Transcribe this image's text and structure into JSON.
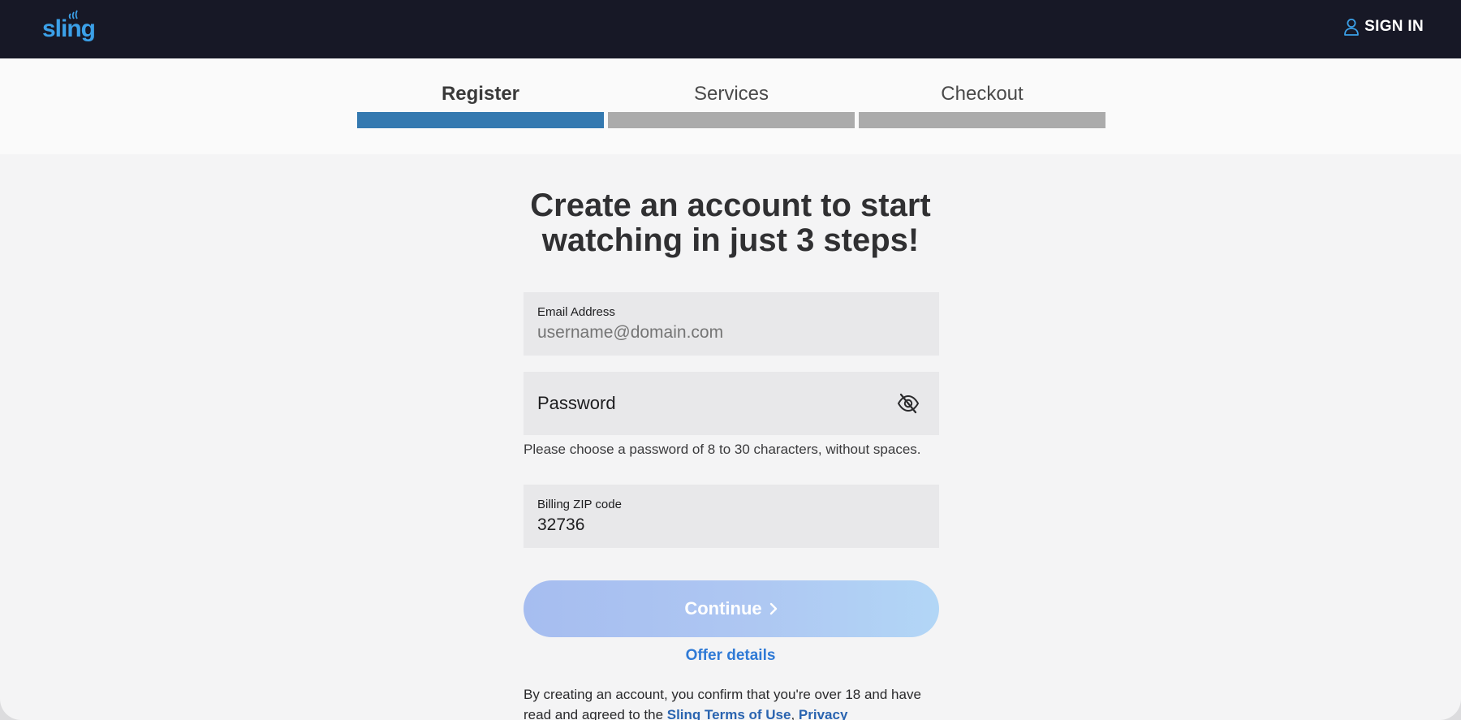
{
  "header": {
    "logo_text": "sling",
    "signin_label": "SIGN IN"
  },
  "stepper": {
    "steps": [
      {
        "label": "Register",
        "active": true
      },
      {
        "label": "Services",
        "active": false
      },
      {
        "label": "Checkout",
        "active": false
      }
    ]
  },
  "main": {
    "heading_line1": "Create an account to start",
    "heading_line2": "watching in just 3 steps!",
    "email": {
      "label": "Email Address",
      "placeholder": "username@domain.com",
      "value": ""
    },
    "password": {
      "label": "Password",
      "hint": "Please choose a password of 8 to 30 characters, without spaces."
    },
    "zip": {
      "label": "Billing ZIP code",
      "value": "32736"
    },
    "continue_label": "Continue",
    "offer_details_label": "Offer details",
    "legal": {
      "text_before": "By creating an account, you confirm that you're over 18 and have read and agreed to the ",
      "terms_link": "Sling Terms of Use",
      "separator": ", ",
      "privacy_link": "Privacy"
    }
  },
  "colors": {
    "header_bg": "#171826",
    "brand": "#3ba0e8",
    "step_active": "#3479b0",
    "step_inactive": "#ababab",
    "link": "#2f7ad6"
  }
}
